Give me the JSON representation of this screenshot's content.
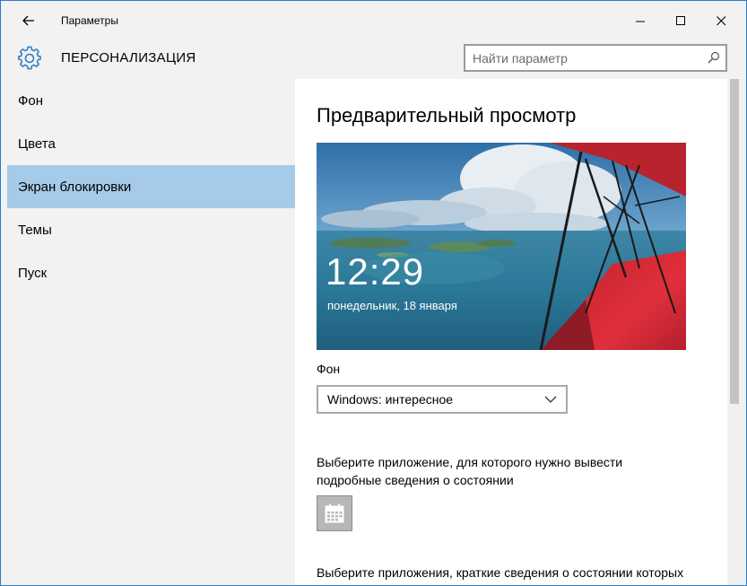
{
  "window": {
    "title": "Параметры"
  },
  "header": {
    "title": "ПЕРСОНАЛИЗАЦИЯ",
    "search_placeholder": "Найти параметр"
  },
  "sidebar": {
    "items": [
      {
        "label": "Фон",
        "active": false
      },
      {
        "label": "Цвета",
        "active": false
      },
      {
        "label": "Экран блокировки",
        "active": true
      },
      {
        "label": "Темы",
        "active": false
      },
      {
        "label": "Пуск",
        "active": false
      }
    ]
  },
  "main": {
    "title": "Предварительный просмотр",
    "preview": {
      "time": "12:29",
      "date": "понедельник, 18 января"
    },
    "background_label": "Фон",
    "background_value": "Windows: интересное",
    "detailed_status_text": "Выберите приложение, для которого нужно вывести подробные сведения о состоянии",
    "detailed_status_line1": "Выберите приложение, для которого нужно вывести",
    "detailed_status_line2": "подробные сведения о состоянии",
    "detailed_status_app_icon": "calendar-icon",
    "quick_status_text": "Выберите приложения, краткие сведения о состоянии которых"
  },
  "colors": {
    "accent": "#2b7bc4",
    "active_nav": "#a6cbe8",
    "chrome_bg": "#f2f2f2"
  }
}
